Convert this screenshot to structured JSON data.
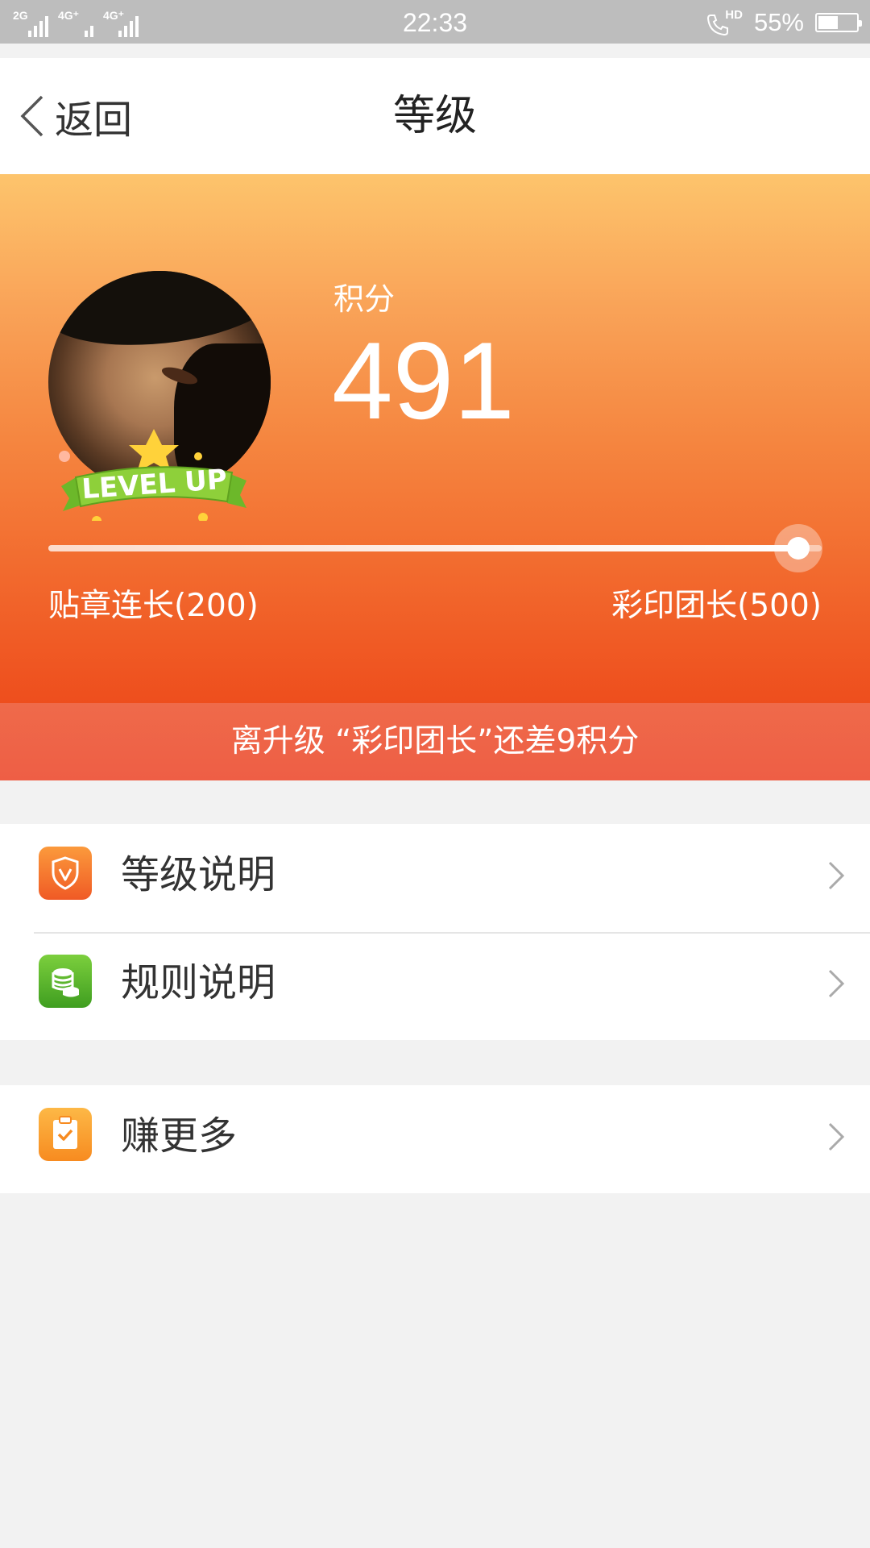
{
  "status_bar": {
    "signal_1": "2G",
    "signal_2": "4G⁺",
    "signal_3": "4G⁺",
    "time": "22:33",
    "hd_label": "HD",
    "battery_percent": "55%",
    "battery_level": 0.55
  },
  "nav": {
    "back_label": "返回",
    "title": "等级"
  },
  "profile": {
    "points_label": "积分",
    "points_value": "491",
    "badge_text": "LEVEL UP"
  },
  "progress": {
    "current_level": "贴章连长(200)",
    "next_level": "彩印团长(500)",
    "fraction": 0.97,
    "upgrade_hint": "离升级 “彩印团长”还差9积分"
  },
  "menu": {
    "group1": [
      {
        "label": "等级说明",
        "icon": "shield-v-icon"
      },
      {
        "label": "规则说明",
        "icon": "coins-icon"
      }
    ],
    "group2": [
      {
        "label": "赚更多",
        "icon": "clipboard-check-icon"
      }
    ]
  },
  "colors": {
    "hero_top": "#fdc46c",
    "hero_bottom": "#ee4e1d",
    "banner": "#ee6448",
    "page_bg": "#f2f2f2"
  }
}
